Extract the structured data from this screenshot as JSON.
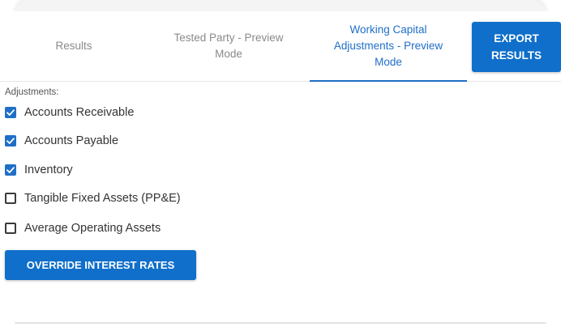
{
  "tabs": [
    {
      "label": "Results",
      "active": false
    },
    {
      "label": "Tested Party - Preview\nMode",
      "active": false
    },
    {
      "label": "Working Capital\nAdjustments - Preview\nMode",
      "active": true
    }
  ],
  "export_button": {
    "label": "EXPORT\nRESULTS"
  },
  "adjustments": {
    "label": "Adjustments:",
    "items": [
      {
        "label": "Accounts Receivable",
        "checked": true
      },
      {
        "label": "Accounts Payable",
        "checked": true
      },
      {
        "label": "Inventory",
        "checked": true
      },
      {
        "label": "Tangible Fixed Assets (PP&E)",
        "checked": false
      },
      {
        "label": "Average Operating Assets",
        "checked": false
      }
    ]
  },
  "override_button": {
    "label": "OVERRIDE INTEREST RATES"
  },
  "colors": {
    "accent": "#1f6fc6",
    "button": "#0f6fca",
    "inactive_tab": "#8a8a8a"
  }
}
